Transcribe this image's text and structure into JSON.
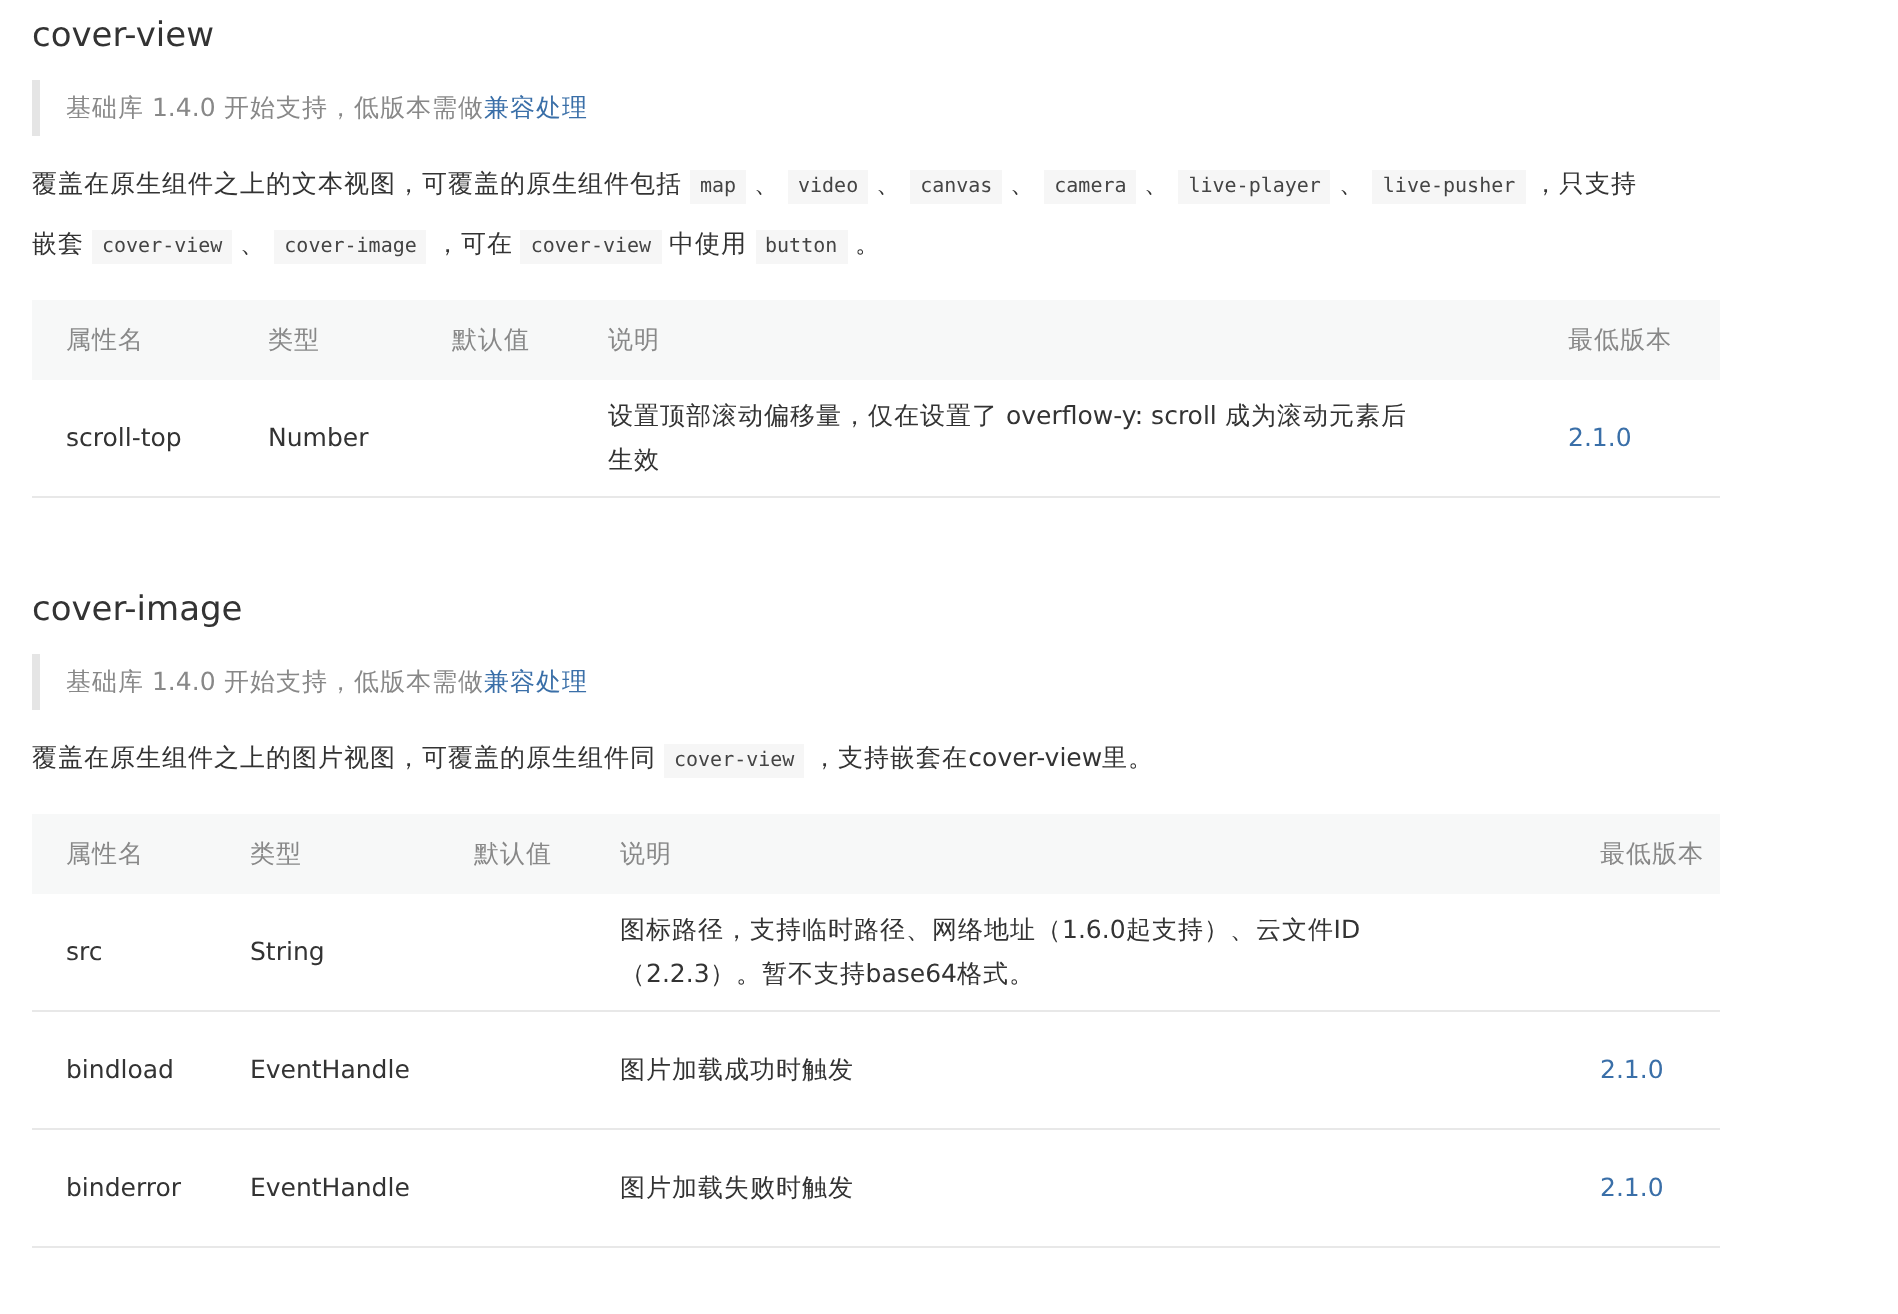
{
  "sections": [
    {
      "title": "cover-view",
      "notice": {
        "text": "基础库 1.4.0 开始支持，低版本需做",
        "link": "兼容处理"
      },
      "description": [
        {
          "kind": "text",
          "text": "覆盖在原生组件之上的文本视图，可覆盖的原生组件包括 "
        },
        {
          "kind": "code",
          "text": "map"
        },
        {
          "kind": "text",
          "text": " 、 "
        },
        {
          "kind": "code",
          "text": "video"
        },
        {
          "kind": "text",
          "text": " 、 "
        },
        {
          "kind": "code",
          "text": "canvas"
        },
        {
          "kind": "text",
          "text": " 、 "
        },
        {
          "kind": "code",
          "text": "camera"
        },
        {
          "kind": "text",
          "text": " 、 "
        },
        {
          "kind": "code",
          "text": "live-player"
        },
        {
          "kind": "text",
          "text": " 、 "
        },
        {
          "kind": "code",
          "text": "live-pusher"
        },
        {
          "kind": "text",
          "text": " ，只支持嵌套 "
        },
        {
          "kind": "code",
          "text": "cover-view"
        },
        {
          "kind": "text",
          "text": " 、 "
        },
        {
          "kind": "code",
          "text": "cover-image"
        },
        {
          "kind": "text",
          "text": " ，可在 "
        },
        {
          "kind": "code",
          "text": "cover-view"
        },
        {
          "kind": "text",
          "text": " 中使用 "
        },
        {
          "kind": "code",
          "text": "button"
        },
        {
          "kind": "text",
          "text": " 。"
        }
      ],
      "table": {
        "columns": [
          "属性名",
          "类型",
          "默认值",
          "说明",
          "最低版本"
        ],
        "rows": [
          {
            "name": "scroll-top",
            "type": "Number",
            "description": "设置顶部滚动偏移量，仅在设置了 overflow-y: scroll 成为滚动元素后生效",
            "version": "2.1.0"
          }
        ]
      }
    },
    {
      "title": "cover-image",
      "notice": {
        "text": "基础库 1.4.0 开始支持，低版本需做",
        "link": "兼容处理"
      },
      "description": [
        {
          "kind": "text",
          "text": "覆盖在原生组件之上的图片视图，可覆盖的原生组件同 "
        },
        {
          "kind": "code",
          "text": "cover-view"
        },
        {
          "kind": "text",
          "text": " ，支持嵌套在cover-view里。"
        }
      ],
      "table": {
        "columns": [
          "属性名",
          "类型",
          "默认值",
          "说明",
          "最低版本"
        ],
        "rows": [
          {
            "name": "src",
            "type": "String",
            "description": "图标路径，支持临时路径、网络地址（1.6.0起支持）、云文件ID（2.2.3）。暂不支持base64格式。"
          },
          {
            "name": "bindload",
            "type": "EventHandle",
            "description": "图片加载成功时触发",
            "version": "2.1.0"
          },
          {
            "name": "binderror",
            "type": "EventHandle",
            "description": "图片加载失败时触发",
            "version": "2.1.0"
          }
        ]
      }
    }
  ]
}
